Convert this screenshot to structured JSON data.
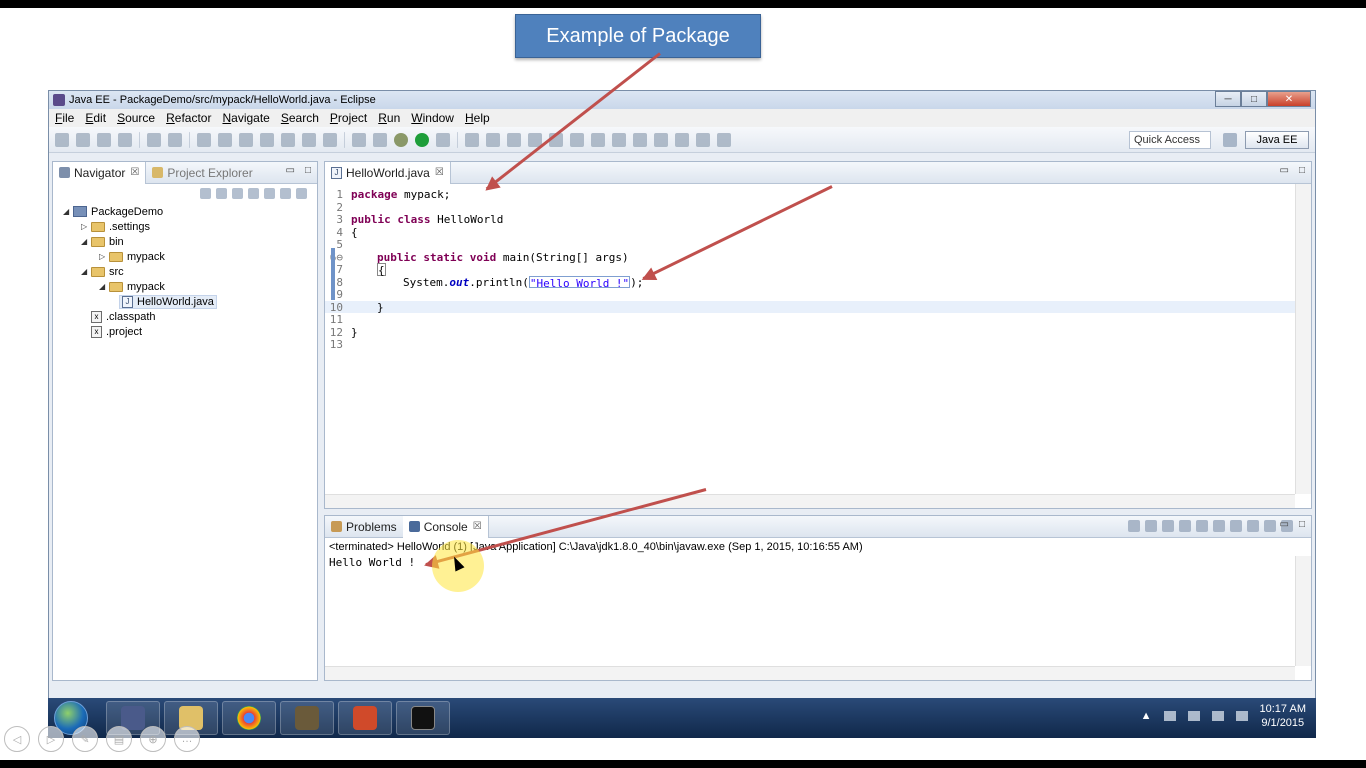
{
  "slide": {
    "title": "Example of Package"
  },
  "window": {
    "title": "Java EE - PackageDemo/src/mypack/HelloWorld.java - Eclipse",
    "minimize": "─",
    "maximize": "□",
    "close": "✕"
  },
  "menu": [
    "File",
    "Edit",
    "Source",
    "Refactor",
    "Navigate",
    "Search",
    "Project",
    "Run",
    "Window",
    "Help"
  ],
  "toolbar": {
    "quick_access": "Quick Access",
    "perspective": "Java EE"
  },
  "navigator": {
    "tabs": [
      {
        "label": "Navigator",
        "close": "☒"
      },
      {
        "label": "Project Explorer"
      }
    ],
    "tree": [
      {
        "label": "PackageDemo",
        "type": "project",
        "depth": 0,
        "expanded": true
      },
      {
        "label": ".settings",
        "type": "folder",
        "depth": 1,
        "expanded": false
      },
      {
        "label": "bin",
        "type": "folder",
        "depth": 1,
        "expanded": true
      },
      {
        "label": "mypack",
        "type": "folder",
        "depth": 2,
        "expanded": false
      },
      {
        "label": "src",
        "type": "folder",
        "depth": 1,
        "expanded": true
      },
      {
        "label": "mypack",
        "type": "folder",
        "depth": 2,
        "expanded": true
      },
      {
        "label": "HelloWorld.java",
        "type": "java",
        "depth": 3,
        "selected": true
      },
      {
        "label": ".classpath",
        "type": "xml",
        "depth": 1
      },
      {
        "label": ".project",
        "type": "xml",
        "depth": 1
      }
    ]
  },
  "editor": {
    "tab_label": "HelloWorld.java",
    "tab_close": "☒",
    "line_numbers": [
      "1",
      "2",
      "3",
      "4",
      "5",
      "6⊖",
      "7",
      "8",
      "9",
      "10",
      "11",
      "12",
      "13"
    ],
    "code": {
      "l1_kw": "package",
      "l1_rest": " mypack;",
      "l3_kw": "public class",
      "l3_rest": " HelloWorld",
      "l4": "{",
      "l6_kw": "public static void",
      "l6_rest": " main(String[] args)",
      "l7": "{",
      "l8_pre": "System.",
      "l8_field": "out",
      "l8_mid": ".println(",
      "l8_str": "\"Hello World !\"",
      "l8_post": ");",
      "l10": "}",
      "l12": "}"
    }
  },
  "console": {
    "tabs": [
      {
        "label": "Problems"
      },
      {
        "label": "Console",
        "close": "☒"
      }
    ],
    "info": "<terminated> HelloWorld (1) [Java Application] C:\\Java\\jdk1.8.0_40\\bin\\javaw.exe (Sep 1, 2015, 10:16:55 AM)",
    "output": "Hello World !"
  },
  "taskbar": {
    "time": "10:17 AM",
    "date": "9/1/2015"
  },
  "colors": {
    "slide_title_bg": "#4f81bd",
    "annotation_arrow": "#c0504d",
    "keyword": "#7f0055",
    "string": "#2a00ff"
  }
}
